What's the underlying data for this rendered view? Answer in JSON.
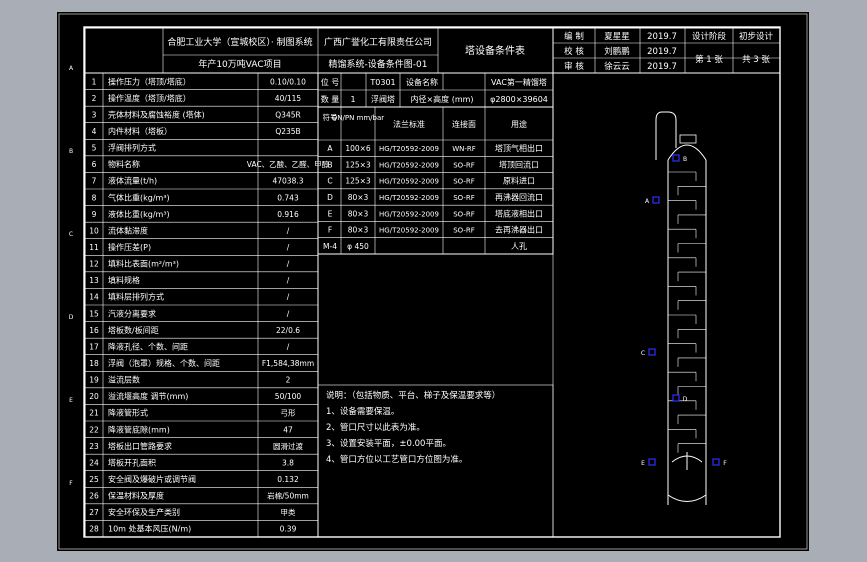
{
  "title_block": {
    "school": "合肥工业大学（宣城校区）· 制图系统",
    "company": "广西广誉化工有限责任公司",
    "project": "年产10万吨VAC项目",
    "drawing_name": "精馏系统-设备条件图-01",
    "doc_type": "塔设备条件表",
    "roles": [
      "编 制",
      "校 核",
      "审 核"
    ],
    "names": [
      "夏星星",
      "刘鹏鹏",
      "徐云云"
    ],
    "dates": [
      "2019.7",
      "2019.7",
      "2019.7"
    ],
    "stage_label": "设计阶段",
    "stage_value": "初步设计",
    "sheet_no": "第 1 张",
    "sheet_total": "共 3 张"
  },
  "border_letters": [
    "A",
    "B",
    "C",
    "D",
    "E",
    "F"
  ],
  "params": [
    {
      "no": "1",
      "label": "操作压力（塔顶/塔底）",
      "value": "0.10/0.10"
    },
    {
      "no": "2",
      "label": "操作温度（塔顶/塔底）",
      "value": "40/115"
    },
    {
      "no": "3",
      "label": "壳体材料及腐蚀裕度  (塔体)",
      "value": "Q345R"
    },
    {
      "no": "4",
      "label": "内件材料（塔板）",
      "value": "Q235B"
    },
    {
      "no": "5",
      "label": "浮阀排列方式",
      "value": ""
    },
    {
      "no": "6",
      "label": "物料名称",
      "value": "VAC、乙酸、乙醛、甲醇"
    },
    {
      "no": "7",
      "label": "液体流量(t/h)",
      "value": "47038.3"
    },
    {
      "no": "8",
      "label": "气体比重(kg/m³)",
      "value": "0.743"
    },
    {
      "no": "9",
      "label": "液体比重(kg/m³)",
      "value": "0.916"
    },
    {
      "no": "10",
      "label": "流体黏滞度",
      "value": "/"
    },
    {
      "no": "11",
      "label": "操作压差(P)",
      "value": "/"
    },
    {
      "no": "12",
      "label": "填料比表面(m²/m³)",
      "value": "/"
    },
    {
      "no": "13",
      "label": "填料规格",
      "value": "/"
    },
    {
      "no": "14",
      "label": "填料层排列方式",
      "value": "/"
    },
    {
      "no": "15",
      "label": "汽液分离要求",
      "value": "/"
    },
    {
      "no": "16",
      "label": "塔板数/板间距",
      "value": "22/0.6"
    },
    {
      "no": "17",
      "label": "降液孔径、个数、间距",
      "value": "/"
    },
    {
      "no": "18",
      "label": "浮阀（泡罩）规格、个数、间距",
      "value": "F1,584,38mm"
    },
    {
      "no": "19",
      "label": "溢流层数",
      "value": "2"
    },
    {
      "no": "20",
      "label": "溢流堰高度 调节(mm)",
      "value": "50/100"
    },
    {
      "no": "21",
      "label": "降液管形式",
      "value": "弓形"
    },
    {
      "no": "22",
      "label": "降液管底隙(mm)",
      "value": "47"
    },
    {
      "no": "23",
      "label": "塔板出口管路要求",
      "value": "圆滑过渡"
    },
    {
      "no": "24",
      "label": "塔板开孔面积",
      "value": "3.8"
    },
    {
      "no": "25",
      "label": "安全阀及爆破片或调节阀",
      "value": "0.132"
    },
    {
      "no": "26",
      "label": "保温材料及厚度",
      "value": "岩棉/50mm"
    },
    {
      "no": "27",
      "label": "安全环保及生产类别",
      "value": "甲类"
    },
    {
      "no": "28",
      "label": "10m 处基本风压(N/m)",
      "value": "0.39"
    }
  ],
  "equipment": {
    "no_label": "位 号",
    "no_value": "T0301",
    "name_label": "设备名称",
    "name_value": "VAC第一精馏塔",
    "count_label": "数 量",
    "count_value": "1",
    "form_label": "浮阀塔",
    "size_label": "内径×高度 (mm)",
    "size_value": "φ2800×39604"
  },
  "nozzle_table": {
    "headers": [
      "符号",
      "DN/PN mm/bar",
      "法兰标准",
      "连接面",
      "用途"
    ],
    "rows": [
      {
        "sym": "A",
        "dn": "100×6",
        "std": "HG/T20592-2009",
        "face": "WN-RF",
        "use": "塔顶气相出口"
      },
      {
        "sym": "B",
        "dn": "125×3",
        "std": "HG/T20592-2009",
        "face": "SO-RF",
        "use": "塔顶回流口"
      },
      {
        "sym": "C",
        "dn": "125×3",
        "std": "HG/T20592-2009",
        "face": "SO-RF",
        "use": "原料进口"
      },
      {
        "sym": "D",
        "dn": "80×3",
        "std": "HG/T20592-2009",
        "face": "SO-RF",
        "use": "再沸器回流口"
      },
      {
        "sym": "E",
        "dn": "80×3",
        "std": "HG/T20592-2009",
        "face": "SO-RF",
        "use": "塔底液相出口"
      },
      {
        "sym": "F",
        "dn": "80×3",
        "std": "HG/T20592-2009",
        "face": "SO-RF",
        "use": "去再沸器出口"
      },
      {
        "sym": "M-4",
        "dn": "φ 450",
        "std": "",
        "face": "",
        "use": "人孔"
      }
    ]
  },
  "notes": {
    "heading": "说明：（包括物质、平台、梯子及保温要求等）",
    "items": [
      "1、设备需要保温。",
      "2、管口尺寸以此表为准。",
      "3、设置安装平面，±0.00平面。",
      "4、管口方位以工艺管口方位图为准。"
    ]
  },
  "drawing_labels": [
    "B",
    "A",
    "C",
    "D",
    "E",
    "F"
  ],
  "colors": {
    "frame": "#ffffff",
    "canvas": "#000000",
    "outer": "#a9aeb6",
    "text": "#ffffff",
    "accent_yellow": "#ffff5a",
    "accent_blue": "#3030ff"
  }
}
